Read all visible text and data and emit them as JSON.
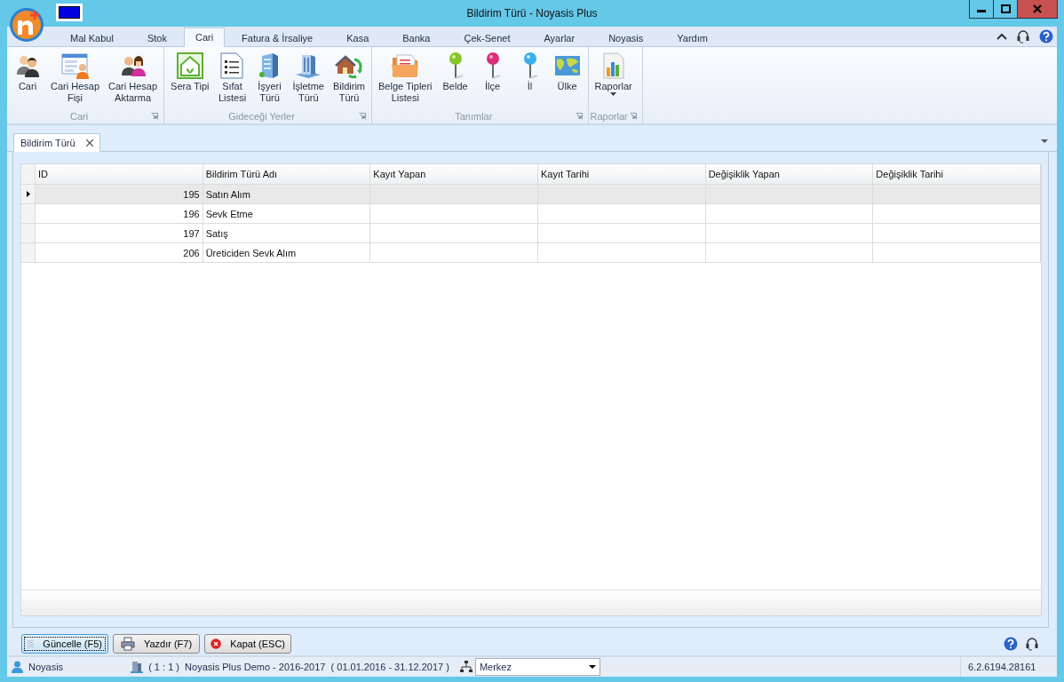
{
  "window": {
    "title": "Bildirim Türü - Noyasis Plus"
  },
  "ribbon": {
    "tabs": [
      {
        "label": "Mal Kabul",
        "selected": false
      },
      {
        "label": "Stok",
        "selected": false
      },
      {
        "label": "Cari",
        "selected": true
      },
      {
        "label": "Fatura & İrsaliye",
        "selected": false
      },
      {
        "label": "Kasa",
        "selected": false
      },
      {
        "label": "Banka",
        "selected": false
      },
      {
        "label": "Çek-Senet",
        "selected": false
      },
      {
        "label": "Ayarlar",
        "selected": false
      },
      {
        "label": "Noyasis",
        "selected": false
      },
      {
        "label": "Yardım",
        "selected": false
      }
    ],
    "groups": [
      {
        "title": "Cari",
        "items": [
          {
            "label": "Cari",
            "dropdown": false
          },
          {
            "label": "Cari Hesap\nFişi",
            "dropdown": false
          },
          {
            "label": "Cari Hesap\nAktarma",
            "dropdown": false
          }
        ]
      },
      {
        "title": "Gideceği Yerler",
        "items": [
          {
            "label": "Sera Tipi",
            "dropdown": false
          },
          {
            "label": "Sıfat\nListesi",
            "dropdown": false
          },
          {
            "label": "İşyeri\nTürü",
            "dropdown": false
          },
          {
            "label": "İşletme\nTürü",
            "dropdown": false
          },
          {
            "label": "Bildirim\nTürü",
            "dropdown": false
          }
        ]
      },
      {
        "title": "Tanımlar",
        "items": [
          {
            "label": "Belge Tipleri\nListesi",
            "dropdown": false
          },
          {
            "label": "Belde",
            "dropdown": false
          },
          {
            "label": "İlçe",
            "dropdown": false
          },
          {
            "label": "İl",
            "dropdown": false
          },
          {
            "label": "Ülke",
            "dropdown": false
          }
        ]
      },
      {
        "title": "Raporlar",
        "items": [
          {
            "label": "Raporlar",
            "dropdown": true
          }
        ]
      }
    ]
  },
  "doc_tabs": [
    {
      "label": "Bildirim Türü",
      "selected": true
    }
  ],
  "table": {
    "columns": [
      "ID",
      "Bildirim Türü Adı",
      "Kayıt Yapan",
      "Kayıt Tarihi",
      "Değişiklik Yapan",
      "Değişiklik Tarihi"
    ],
    "rows": [
      {
        "id": "195",
        "name": "Satın Alım",
        "selected": true
      },
      {
        "id": "196",
        "name": "Sevk Etme",
        "selected": false
      },
      {
        "id": "197",
        "name": "Satış",
        "selected": false
      },
      {
        "id": "206",
        "name": "Üreticiden Sevk Alım",
        "selected": false
      }
    ]
  },
  "buttons": [
    {
      "label": "Güncelle (F5)",
      "focused": true
    },
    {
      "label": "Yazdır (F7)",
      "focused": false
    },
    {
      "label": "Kapat (ESC)",
      "focused": false
    }
  ],
  "status_bar": {
    "user": "Noyasis",
    "company": "( 1 : 1 )  Noyasis Plus Demo - 2016-2017  ( 01.01.2016 - 31.12.2017 )",
    "branch": "Merkez",
    "version": "6.2.6194.28161"
  }
}
